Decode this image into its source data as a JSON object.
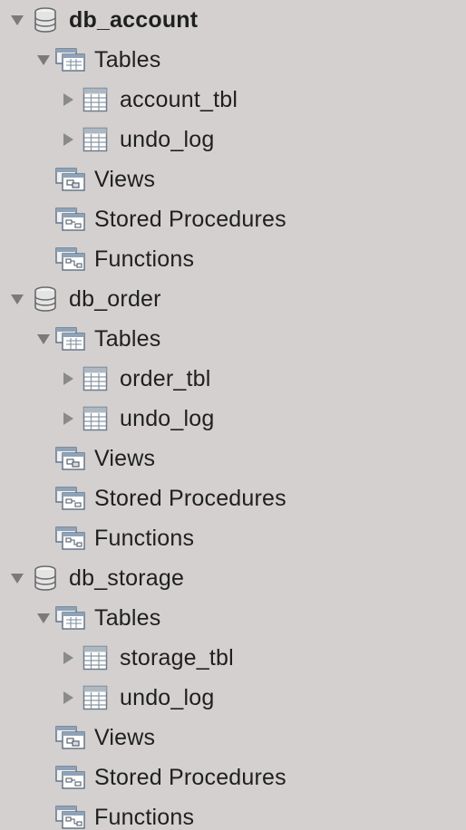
{
  "databases": [
    {
      "name": "db_account",
      "bold": true,
      "tables_label": "Tables",
      "tables": [
        "account_tbl",
        "undo_log"
      ],
      "views_label": "Views",
      "procedures_label": "Stored Procedures",
      "functions_label": "Functions"
    },
    {
      "name": "db_order",
      "bold": false,
      "tables_label": "Tables",
      "tables": [
        "order_tbl",
        "undo_log"
      ],
      "views_label": "Views",
      "procedures_label": "Stored Procedures",
      "functions_label": "Functions"
    },
    {
      "name": "db_storage",
      "bold": false,
      "tables_label": "Tables",
      "tables": [
        "storage_tbl",
        "undo_log"
      ],
      "views_label": "Views",
      "procedures_label": "Stored Procedures",
      "functions_label": "Functions"
    }
  ],
  "icons": {
    "database": "database-icon",
    "folder": "folder-icon",
    "table": "table-icon",
    "views": "views-icon",
    "procedures": "procedures-icon",
    "functions": "functions-icon"
  },
  "colors": {
    "background": "#d4d0d0",
    "text": "#1f1f1f",
    "disclosure": "#7a7a7a"
  }
}
